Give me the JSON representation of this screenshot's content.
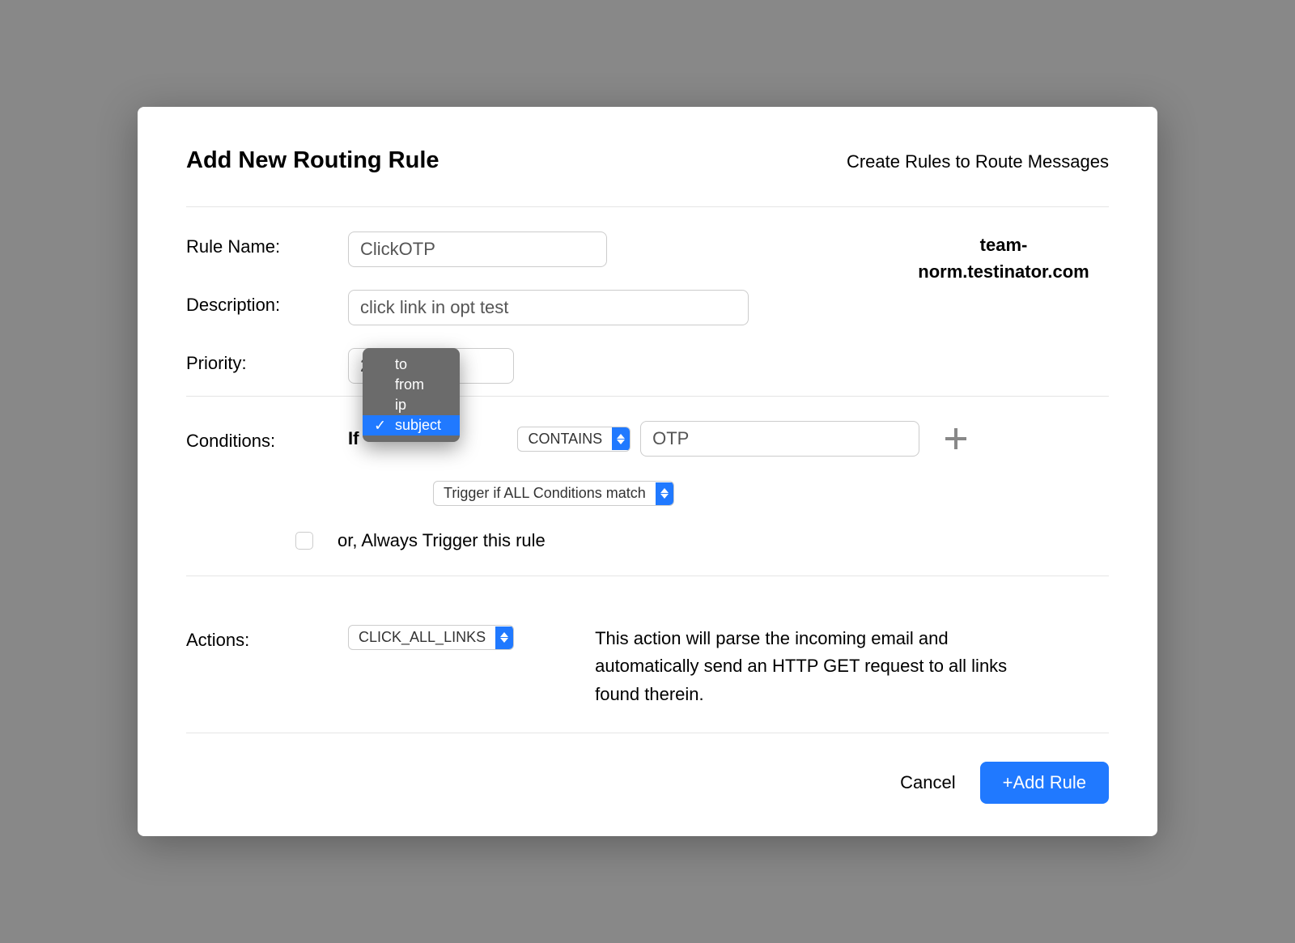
{
  "header": {
    "title": "Add New Routing Rule",
    "subtitle": "Create Rules to Route Messages"
  },
  "labels": {
    "rule_name": "Rule Name:",
    "description": "Description:",
    "priority": "Priority:",
    "conditions": "Conditions:",
    "actions": "Actions:"
  },
  "fields": {
    "rule_name": "ClickOTP",
    "description": "click link in opt test",
    "priority": "20",
    "domain": "team-norm.testinator.com"
  },
  "conditions": {
    "if_prefix": "If",
    "field_options": [
      "to",
      "from",
      "ip",
      "subject"
    ],
    "field_selected": "subject",
    "operator": "CONTAINS",
    "value": "OTP",
    "trigger_mode": "Trigger if ALL Conditions match",
    "always_label": "or, Always Trigger this rule",
    "always_checked": false
  },
  "actions": {
    "selected": "CLICK_ALL_LINKS",
    "description": "This action will parse the incoming email and automatically send an HTTP GET request to all links found therein."
  },
  "footer": {
    "cancel": "Cancel",
    "add": "+Add Rule"
  }
}
